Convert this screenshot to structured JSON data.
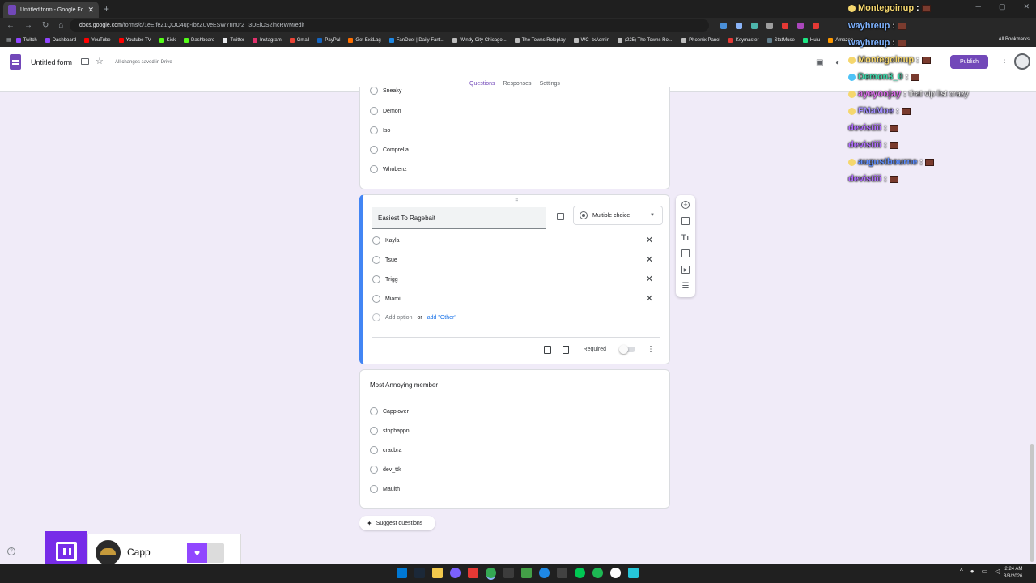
{
  "browser": {
    "tab_title": "Untitled form - Google Forms",
    "url_host": "docs.google.com",
    "url_path": "/forms/d/1eEIfeZ1QOO4ug-IbzZUveESWYrIn0r2_i3DEiOS2incRWM/edit",
    "bookmarks": [
      "Twitch",
      "Dashboard",
      "YouTube",
      "Youtube TV",
      "Kick",
      "Dashboard",
      "Twitter",
      "Instagram",
      "Gmail",
      "PayPal",
      "Get ExitLag",
      "FanDuel | Daily Fant...",
      "Windy City Chicago...",
      "The Towns Roleplay",
      "WC- txAdmin",
      "(225) The Towns Rol...",
      "Phoenix Panel",
      "Keymaster",
      "StatMuse",
      "Hulu",
      "Amazon"
    ],
    "all_bookmarks": "All Bookmarks"
  },
  "forms": {
    "title": "Untitled form",
    "save_status": "All changes saved in Drive",
    "publish": "Publish",
    "tabs": [
      "Questions",
      "Responses",
      "Settings"
    ]
  },
  "question1": {
    "options": [
      "Sneaky",
      "Demon",
      "Iso",
      "Comprella",
      "Whobenz"
    ]
  },
  "question2": {
    "title": "Easiest To Ragebait",
    "type": "Multiple choice",
    "options": [
      "Kayla",
      "Tsue",
      "Trigg",
      "Miami"
    ],
    "add_option": "Add option",
    "or": "or",
    "add_other": "add \"Other\"",
    "required": "Required"
  },
  "question3": {
    "title": "Most Annoying member",
    "options": [
      "Capplover",
      "stopbappn",
      "cracbra",
      "dev_ttk",
      "Mauith"
    ]
  },
  "suggest": "Suggest questions",
  "twitch": {
    "name": "Capp"
  },
  "chat": [
    {
      "user": "Montegoinup",
      "color": "#f5d76e",
      "msg": ""
    },
    {
      "user": "wayhreup",
      "color": "#7fb3ff",
      "msg": ""
    },
    {
      "user": "wayhreup",
      "color": "#7fb3ff",
      "msg": ""
    },
    {
      "user": "Montegoinup",
      "color": "#f5d76e",
      "msg": ""
    },
    {
      "user": "Demon3_0",
      "color": "#39d6a8",
      "msg": ""
    },
    {
      "user": "ayeyoojay",
      "color": "#d96ee8",
      "msg": "that vip list crazy"
    },
    {
      "user": "FMaMoe",
      "color": "#a28dff",
      "msg": ""
    },
    {
      "user": "devistiii",
      "color": "#b06cff",
      "msg": ""
    },
    {
      "user": "devistiii",
      "color": "#b06cff",
      "msg": ""
    },
    {
      "user": "augustbourne",
      "color": "#5c8dff",
      "msg": ""
    },
    {
      "user": "devistiii",
      "color": "#b06cff",
      "msg": ""
    }
  ],
  "taskbar": {
    "time": "2:24 AM",
    "date": "3/3/2026"
  },
  "colors": {
    "accent": "#7248b9",
    "active_border": "#4285f4",
    "background": "#f0ebf8"
  }
}
